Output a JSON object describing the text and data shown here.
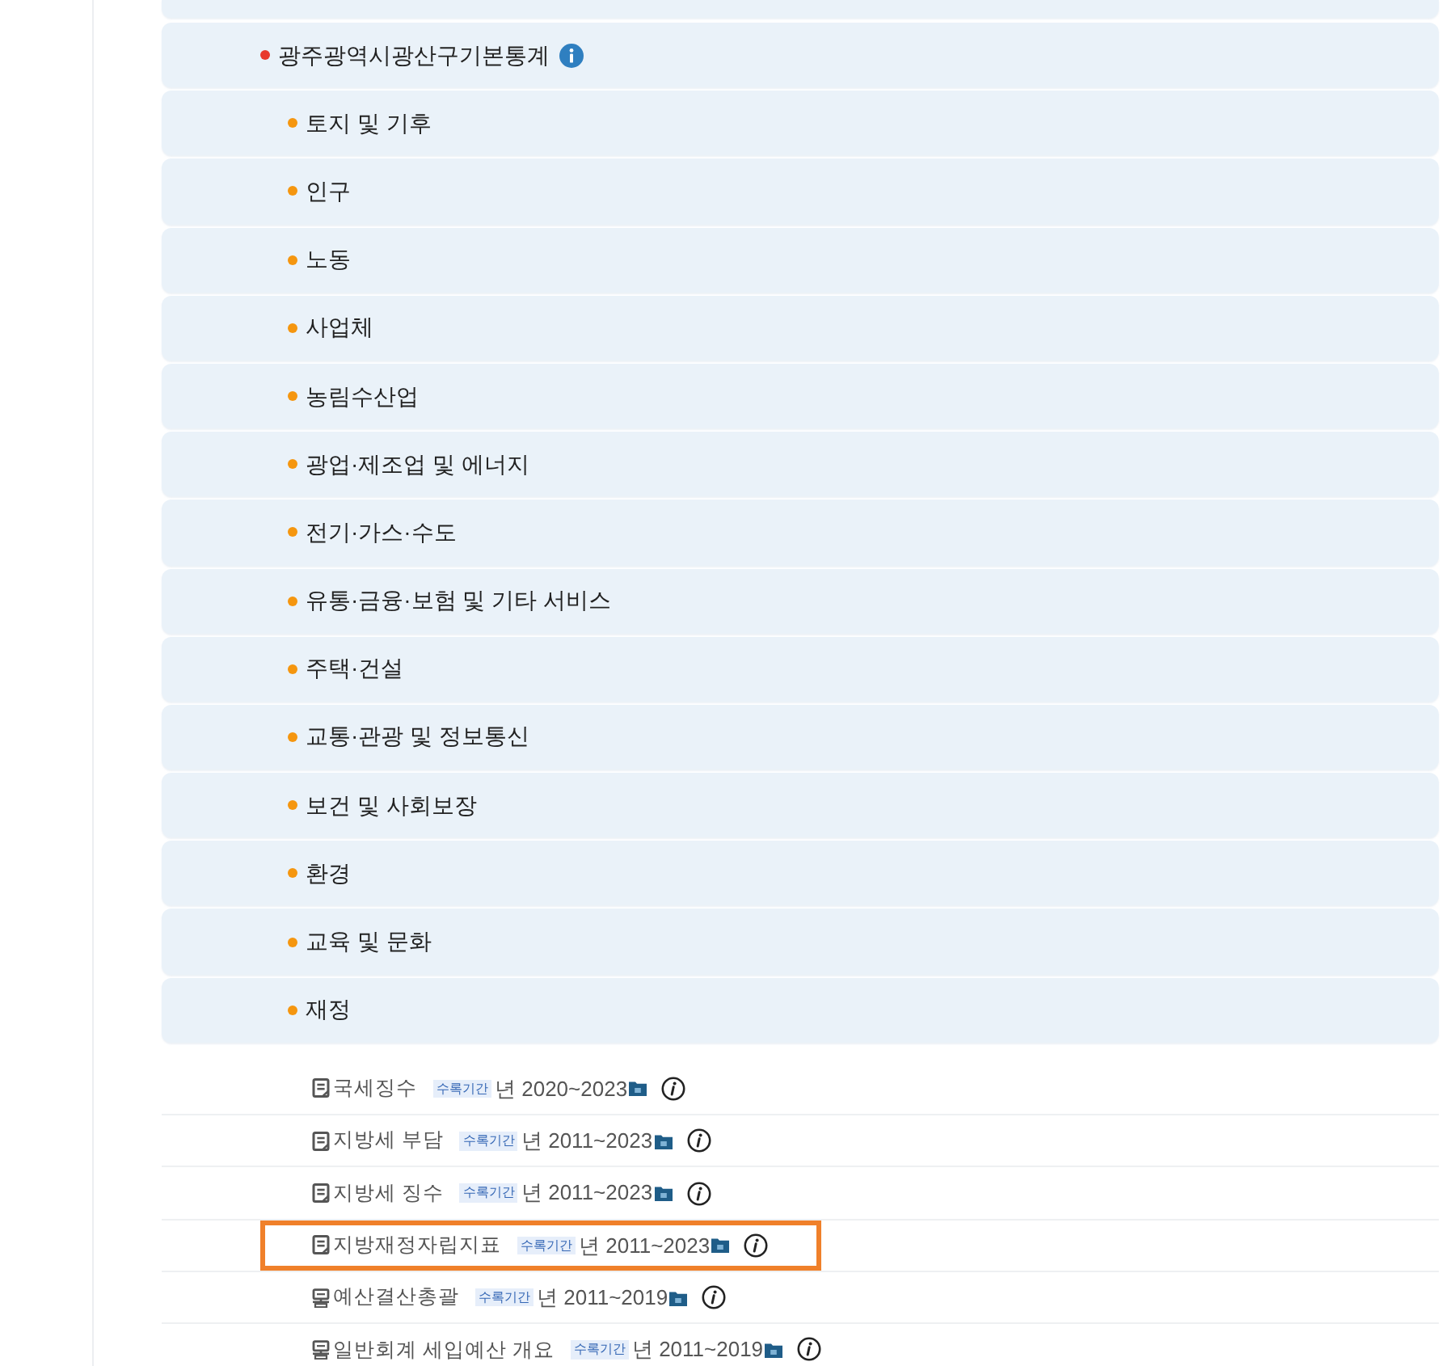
{
  "category": {
    "title": "광주광역시광산구기본통계",
    "children": [
      {
        "label": "토지 및 기후"
      },
      {
        "label": "인구"
      },
      {
        "label": "노동"
      },
      {
        "label": "사업체"
      },
      {
        "label": "농림수산업"
      },
      {
        "label": "광업·제조업 및 에너지"
      },
      {
        "label": "전기·가스·수도"
      },
      {
        "label": "유통·금융·보험 및 기타 서비스"
      },
      {
        "label": "주택·건설"
      },
      {
        "label": "교통·관광 및 정보통신"
      },
      {
        "label": "보건 및 사회보장"
      },
      {
        "label": "환경"
      },
      {
        "label": "교육 및 문화"
      },
      {
        "label": "재정",
        "children": [
          {
            "kind": "doc",
            "name": "국세징수",
            "tag": "수록기간",
            "period": "년 2020~2023",
            "selected": false
          },
          {
            "kind": "doc",
            "name": "지방세 부담",
            "tag": "수록기간",
            "period": "년 2011~2023",
            "selected": false
          },
          {
            "kind": "doc",
            "name": "지방세 징수",
            "tag": "수록기간",
            "period": "년 2011~2023",
            "selected": false
          },
          {
            "kind": "doc",
            "name": "지방재정자립지표",
            "tag": "수록기간",
            "period": "년 2011~2023",
            "selected": true
          },
          {
            "kind": "sheet",
            "name": "예산결산총괄",
            "tag": "수록기간",
            "period": "년 2011~2019",
            "selected": false
          },
          {
            "kind": "sheet",
            "name": "일반회계 세입예산 개요",
            "tag": "수록기간",
            "period": "년 2011~2019",
            "selected": false
          }
        ]
      }
    ]
  }
}
